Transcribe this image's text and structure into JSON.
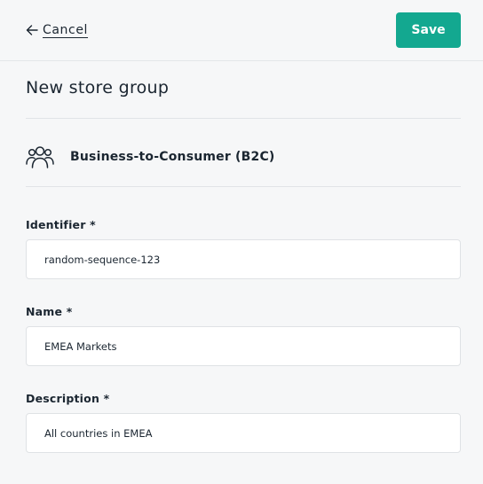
{
  "header": {
    "cancel_label": "Cancel",
    "save_label": "Save",
    "accent_color": "#13a890"
  },
  "page": {
    "title": "New store group"
  },
  "group_type": {
    "icon": "users-icon",
    "label": "Business-to-Consumer (B2C)"
  },
  "form": {
    "identifier": {
      "label": "Identifier *",
      "value": "random-sequence-123"
    },
    "name": {
      "label": "Name *",
      "value": "EMEA Markets"
    },
    "description": {
      "label": "Description *",
      "value": "All countries in EMEA"
    }
  }
}
